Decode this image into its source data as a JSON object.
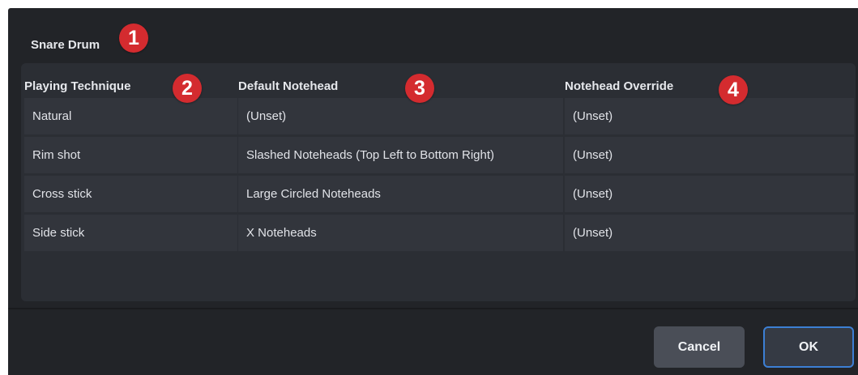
{
  "dialog": {
    "title": "Snare Drum",
    "columns": [
      "Playing Technique",
      "Default Notehead",
      "Notehead Override"
    ],
    "rows": [
      {
        "technique": "Natural",
        "default_notehead": "(Unset)",
        "override": "(Unset)"
      },
      {
        "technique": "Rim shot",
        "default_notehead": "Slashed Noteheads (Top Left to Bottom Right)",
        "override": "(Unset)"
      },
      {
        "technique": "Cross stick",
        "default_notehead": "Large Circled Noteheads",
        "override": "(Unset)"
      },
      {
        "technique": "Side stick",
        "default_notehead": "X Noteheads",
        "override": "(Unset)"
      }
    ],
    "buttons": {
      "cancel": "Cancel",
      "ok": "OK"
    }
  },
  "callouts": [
    "1",
    "2",
    "3",
    "4"
  ],
  "colors": {
    "background": "#222428",
    "cell": "#32353c",
    "callout": "#d42b2f",
    "ok_border": "#3c7fd4"
  }
}
